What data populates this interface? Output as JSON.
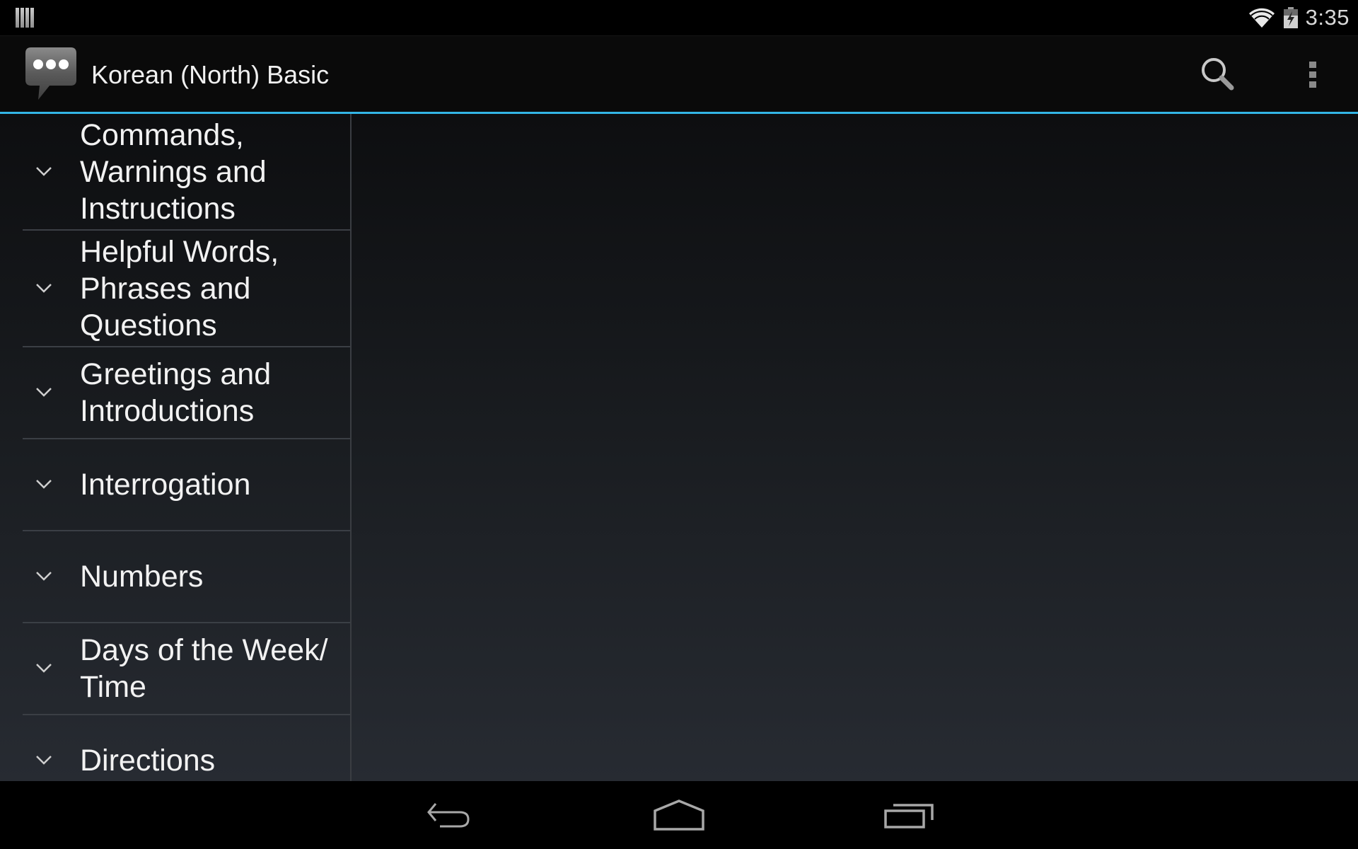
{
  "status_bar": {
    "notification_icon": "barcode-notification-icon",
    "wifi_icon": "wifi-icon",
    "battery_icon": "battery-charging-icon",
    "time": "3:35"
  },
  "action_bar": {
    "app_icon": "chat-bubble-icon",
    "title": "Korean (North) Basic",
    "search_icon": "search-icon",
    "overflow_icon": "overflow-menu-icon"
  },
  "accent_color": "#33b5e5",
  "categories": [
    {
      "label": "Commands, Warnings and Instructions",
      "icon": "chevron-down-icon"
    },
    {
      "label": "Helpful Words, Phrases and Questions",
      "icon": "chevron-down-icon"
    },
    {
      "label": "Greetings and Introductions",
      "icon": "chevron-down-icon"
    },
    {
      "label": "Interrogation",
      "icon": "chevron-down-icon"
    },
    {
      "label": "Numbers",
      "icon": "chevron-down-icon"
    },
    {
      "label": "Days of the Week/ Time",
      "icon": "chevron-down-icon"
    },
    {
      "label": "Directions",
      "icon": "chevron-down-icon"
    }
  ],
  "nav_bar": {
    "back": "back-icon",
    "home": "home-icon",
    "recents": "recent-apps-icon"
  }
}
